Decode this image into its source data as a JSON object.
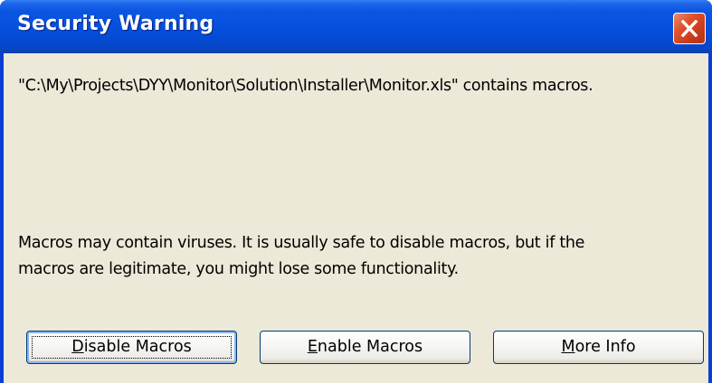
{
  "window": {
    "title": "Security Warning"
  },
  "message": {
    "file_line": "\"C:\\My\\Projects\\DYY\\Monitor\\Solution\\Installer\\Monitor.xls\" contains macros.",
    "warning_line1": "Macros may contain viruses. It is usually safe to disable macros, but if the",
    "warning_line2": "macros are legitimate, you might lose some functionality."
  },
  "buttons": {
    "disable": {
      "accel": "D",
      "rest": "isable Macros"
    },
    "enable": {
      "accel": "E",
      "rest": "nable Macros"
    },
    "more_info": {
      "accel": "M",
      "rest": "ore Info"
    }
  },
  "icons": {
    "close": "close-x-icon"
  },
  "colors": {
    "titlebar": "#0550dd",
    "client_bg": "#ece9d8",
    "close_button": "#e0522e",
    "button_border": "#003c74"
  }
}
